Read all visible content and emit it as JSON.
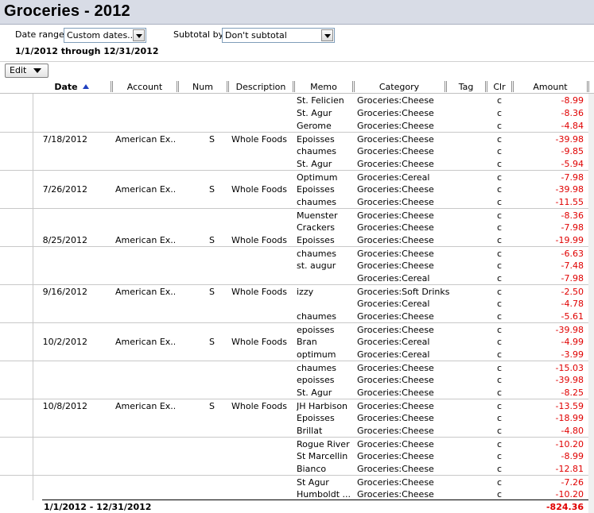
{
  "window": {
    "title": "Groceries - 2012"
  },
  "filters": {
    "date_range_label": "Date range:",
    "date_range_value": "Custom dates...",
    "subtotal_label": "Subtotal by:",
    "subtotal_value": "Don't subtotal",
    "range_text": "1/1/2012 through 12/31/2012"
  },
  "toolbar": {
    "edit_label": "Edit"
  },
  "columns": [
    "Date",
    "Account",
    "Num",
    "Description",
    "Memo",
    "Category",
    "Tag",
    "Clr",
    "Amount"
  ],
  "rows": [
    {
      "date": "",
      "account": "",
      "num": "",
      "desc": "",
      "memo": "St. Felicien",
      "cat": "Groceries:Cheese",
      "clr": "c",
      "amt": "-8.99",
      "sep": false
    },
    {
      "date": "",
      "account": "",
      "num": "",
      "desc": "",
      "memo": "St. Agur",
      "cat": "Groceries:Cheese",
      "clr": "c",
      "amt": "-8.36",
      "sep": false
    },
    {
      "date": "",
      "account": "",
      "num": "",
      "desc": "",
      "memo": "Gerome",
      "cat": "Groceries:Cheese",
      "clr": "c",
      "amt": "-4.84",
      "sep": false
    },
    {
      "date": "7/18/2012",
      "account": "American Ex...",
      "num": "S",
      "desc": "Whole Foods",
      "memo": "Epoisses",
      "cat": "Groceries:Cheese",
      "clr": "c",
      "amt": "-39.98",
      "sep": true
    },
    {
      "date": "",
      "account": "",
      "num": "",
      "desc": "",
      "memo": "chaumes",
      "cat": "Groceries:Cheese",
      "clr": "c",
      "amt": "-9.85",
      "sep": false
    },
    {
      "date": "",
      "account": "",
      "num": "",
      "desc": "",
      "memo": "St. Agur",
      "cat": "Groceries:Cheese",
      "clr": "c",
      "amt": "-5.94",
      "sep": false
    },
    {
      "date": "",
      "account": "",
      "num": "",
      "desc": "",
      "memo": "Optimum",
      "cat": "Groceries:Cereal",
      "clr": "c",
      "amt": "-7.98",
      "sep": true
    },
    {
      "date": "7/26/2012",
      "account": "American Ex...",
      "num": "S",
      "desc": "Whole Foods",
      "memo": "Epoisses",
      "cat": "Groceries:Cheese",
      "clr": "c",
      "amt": "-39.98",
      "sep": false
    },
    {
      "date": "",
      "account": "",
      "num": "",
      "desc": "",
      "memo": "chaumes",
      "cat": "Groceries:Cheese",
      "clr": "c",
      "amt": "-11.55",
      "sep": false
    },
    {
      "date": "",
      "account": "",
      "num": "",
      "desc": "",
      "memo": "Muenster",
      "cat": "Groceries:Cheese",
      "clr": "c",
      "amt": "-8.36",
      "sep": true
    },
    {
      "date": "",
      "account": "",
      "num": "",
      "desc": "",
      "memo": "Crackers",
      "cat": "Groceries:Cheese",
      "clr": "c",
      "amt": "-7.98",
      "sep": false
    },
    {
      "date": "8/25/2012",
      "account": "American Ex...",
      "num": "S",
      "desc": "Whole Foods",
      "memo": "Epoisses",
      "cat": "Groceries:Cheese",
      "clr": "c",
      "amt": "-19.99",
      "sep": false
    },
    {
      "date": "",
      "account": "",
      "num": "",
      "desc": "",
      "memo": "chaumes",
      "cat": "Groceries:Cheese",
      "clr": "c",
      "amt": "-6.63",
      "sep": true
    },
    {
      "date": "",
      "account": "",
      "num": "",
      "desc": "",
      "memo": "st. augur",
      "cat": "Groceries:Cheese",
      "clr": "c",
      "amt": "-7.48",
      "sep": false
    },
    {
      "date": "",
      "account": "",
      "num": "",
      "desc": "",
      "memo": "",
      "cat": "Groceries:Cereal",
      "clr": "c",
      "amt": "-7.98",
      "sep": false
    },
    {
      "date": "9/16/2012",
      "account": "American Ex...",
      "num": "S",
      "desc": "Whole Foods",
      "memo": "izzy",
      "cat": "Groceries:Soft Drinks",
      "clr": "c",
      "amt": "-2.50",
      "sep": true
    },
    {
      "date": "",
      "account": "",
      "num": "",
      "desc": "",
      "memo": "",
      "cat": "Groceries:Cereal",
      "clr": "c",
      "amt": "-4.78",
      "sep": false
    },
    {
      "date": "",
      "account": "",
      "num": "",
      "desc": "",
      "memo": "chaumes",
      "cat": "Groceries:Cheese",
      "clr": "c",
      "amt": "-5.61",
      "sep": false
    },
    {
      "date": "",
      "account": "",
      "num": "",
      "desc": "",
      "memo": "epoisses",
      "cat": "Groceries:Cheese",
      "clr": "c",
      "amt": "-39.98",
      "sep": true
    },
    {
      "date": "10/2/2012",
      "account": "American Ex...",
      "num": "S",
      "desc": "Whole Foods",
      "memo": "Bran",
      "cat": "Groceries:Cereal",
      "clr": "c",
      "amt": "-4.99",
      "sep": false
    },
    {
      "date": "",
      "account": "",
      "num": "",
      "desc": "",
      "memo": "optimum",
      "cat": "Groceries:Cereal",
      "clr": "c",
      "amt": "-3.99",
      "sep": false
    },
    {
      "date": "",
      "account": "",
      "num": "",
      "desc": "",
      "memo": "chaumes",
      "cat": "Groceries:Cheese",
      "clr": "c",
      "amt": "-15.03",
      "sep": true
    },
    {
      "date": "",
      "account": "",
      "num": "",
      "desc": "",
      "memo": "epoisses",
      "cat": "Groceries:Cheese",
      "clr": "c",
      "amt": "-39.98",
      "sep": false
    },
    {
      "date": "",
      "account": "",
      "num": "",
      "desc": "",
      "memo": "St. Agur",
      "cat": "Groceries:Cheese",
      "clr": "c",
      "amt": "-8.25",
      "sep": false
    },
    {
      "date": "10/8/2012",
      "account": "American Ex...",
      "num": "S",
      "desc": "Whole Foods",
      "memo": "JH Harbison",
      "cat": "Groceries:Cheese",
      "clr": "c",
      "amt": "-13.59",
      "sep": true
    },
    {
      "date": "",
      "account": "",
      "num": "",
      "desc": "",
      "memo": "Epoisses",
      "cat": "Groceries:Cheese",
      "clr": "c",
      "amt": "-18.99",
      "sep": false
    },
    {
      "date": "",
      "account": "",
      "num": "",
      "desc": "",
      "memo": "Brillat",
      "cat": "Groceries:Cheese",
      "clr": "c",
      "amt": "-4.80",
      "sep": false
    },
    {
      "date": "",
      "account": "",
      "num": "",
      "desc": "",
      "memo": "Rogue River",
      "cat": "Groceries:Cheese",
      "clr": "c",
      "amt": "-10.20",
      "sep": true
    },
    {
      "date": "",
      "account": "",
      "num": "",
      "desc": "",
      "memo": "St Marcellin",
      "cat": "Groceries:Cheese",
      "clr": "c",
      "amt": "-8.99",
      "sep": false
    },
    {
      "date": "",
      "account": "",
      "num": "",
      "desc": "",
      "memo": "Bianco",
      "cat": "Groceries:Cheese",
      "clr": "c",
      "amt": "-12.81",
      "sep": false
    },
    {
      "date": "",
      "account": "",
      "num": "",
      "desc": "",
      "memo": "St Agur",
      "cat": "Groceries:Cheese",
      "clr": "c",
      "amt": "-7.26",
      "sep": true
    },
    {
      "date": "",
      "account": "",
      "num": "",
      "desc": "",
      "memo": "Humboldt ...",
      "cat": "Groceries:Cheese",
      "clr": "c",
      "amt": "-10.20",
      "sep": false
    }
  ],
  "total": {
    "label": "1/1/2012 - 12/31/2012",
    "amount": "-824.36"
  },
  "colors": {
    "negative": "#e00000",
    "sort_arrow": "#2040c0",
    "titlebar": "#d8dce6"
  }
}
